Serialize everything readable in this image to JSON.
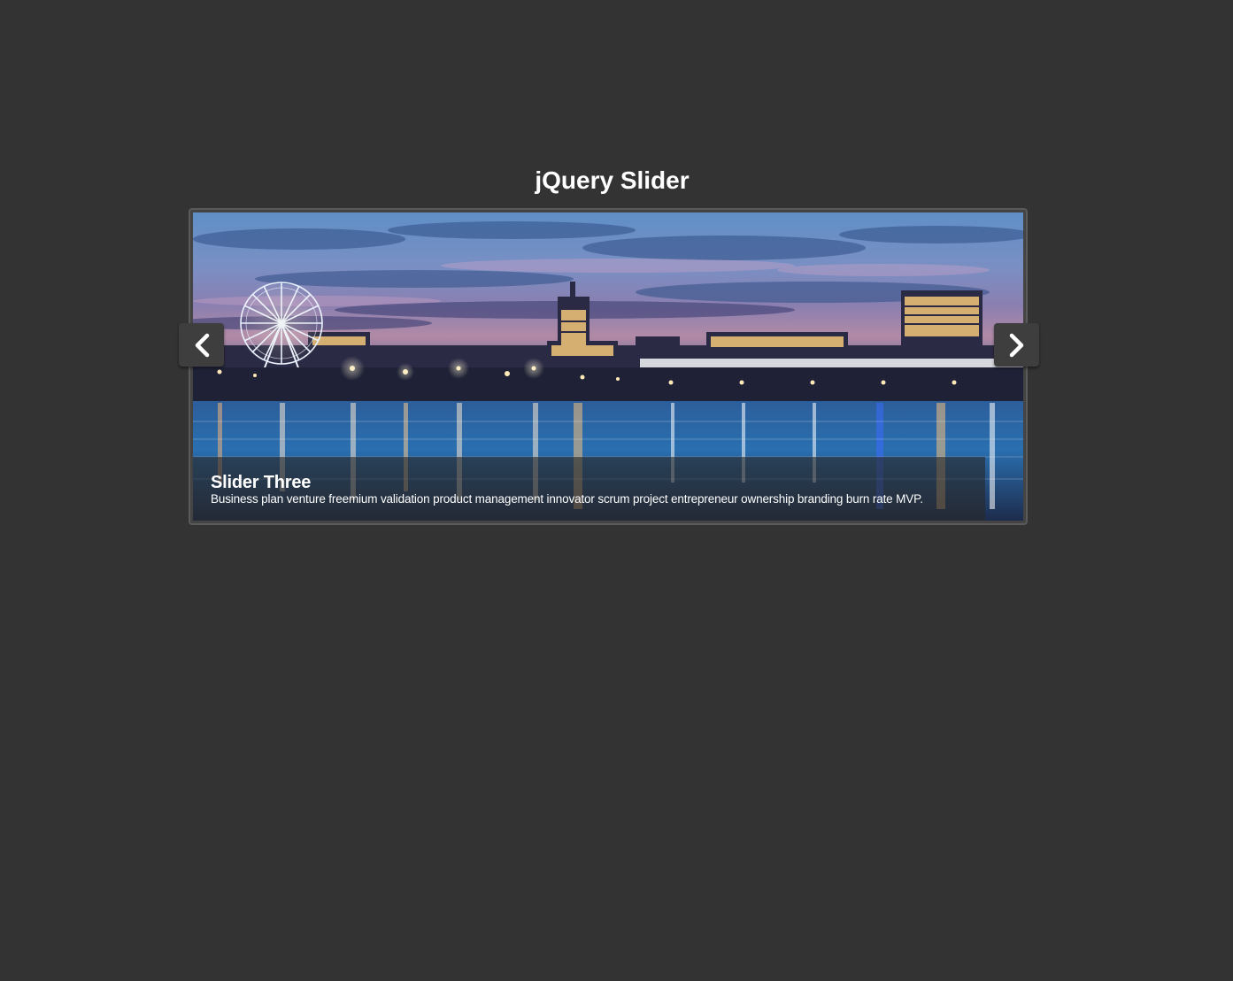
{
  "page": {
    "title": "jQuery Slider"
  },
  "slider": {
    "current_slide": {
      "title": "Slider Three",
      "description": "Business plan venture freemium validation product management innovator scrum project entrepreneur ownership branding burn rate MVP.",
      "image": "city-waterfront-at-dusk-with-ferris-wheel"
    },
    "controls": {
      "prev_icon": "chevron-left-icon",
      "next_icon": "chevron-right-icon"
    }
  },
  "colors": {
    "background": "#333333",
    "frame_border": "#5a5a5a",
    "nav_button": "#3e3e3e",
    "text": "#ffffff"
  }
}
